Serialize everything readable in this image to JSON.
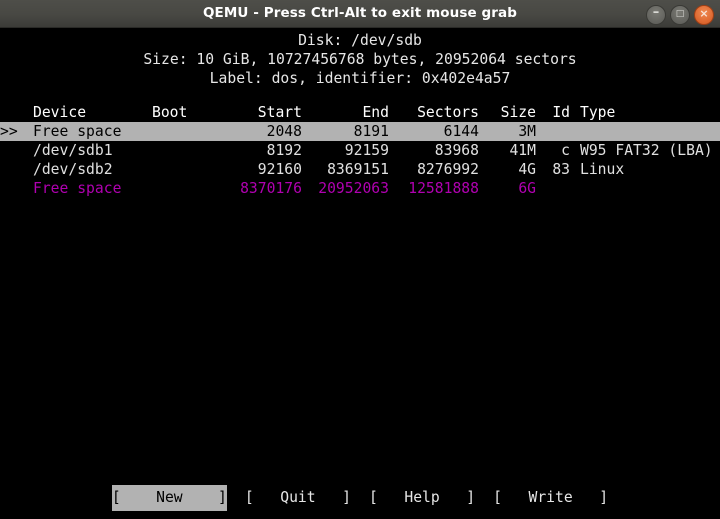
{
  "window": {
    "title": "QEMU - Press Ctrl-Alt to exit mouse grab",
    "controls": {
      "minimize_label": "–",
      "maximize_label": "□",
      "close_label": "×"
    }
  },
  "colors": {
    "titlebar": "#484843",
    "terminal_bg": "#000000",
    "terminal_fg": "#d8d8d8",
    "selection_bg": "#b2b2b2",
    "selection_fg": "#000000",
    "freespace_magenta": "#b000b0",
    "close_button": "#e06b33"
  },
  "disk_header": {
    "line1": "Disk: /dev/sdb",
    "line2": "Size: 10 GiB, 10727456768 bytes, 20952064 sectors",
    "line3": "Label: dos, identifier: 0x402e4a57"
  },
  "table": {
    "columns": {
      "device": "Device",
      "boot": "Boot",
      "start": "Start",
      "end": "End",
      "sectors": "Sectors",
      "size": "Size",
      "id": "Id",
      "type": "Type"
    },
    "rows": [
      {
        "marker": ">>",
        "device": "Free space",
        "boot": "",
        "start": "2048",
        "end": "8191",
        "sectors": "6144",
        "size": "3M",
        "id": "",
        "type": "",
        "state": "selected"
      },
      {
        "marker": "",
        "device": "/dev/sdb1",
        "boot": "",
        "start": "8192",
        "end": "92159",
        "sectors": "83968",
        "size": "41M",
        "id": "c",
        "type": "W95 FAT32 (LBA)",
        "state": "normal"
      },
      {
        "marker": "",
        "device": "/dev/sdb2",
        "boot": "",
        "start": "92160",
        "end": "8369151",
        "sectors": "8276992",
        "size": "4G",
        "id": "83",
        "type": "Linux",
        "state": "normal"
      },
      {
        "marker": "",
        "device": "Free space",
        "boot": "",
        "start": "8370176",
        "end": "20952063",
        "sectors": "12581888",
        "size": "6G",
        "id": "",
        "type": "",
        "state": "freespace"
      }
    ]
  },
  "menu": {
    "buttons": [
      {
        "label": "[    New    ]",
        "name": "new",
        "selected": true
      },
      {
        "label": "[   Quit   ]",
        "name": "quit",
        "selected": false
      },
      {
        "label": "[   Help   ]",
        "name": "help",
        "selected": false
      },
      {
        "label": "[   Write   ]",
        "name": "write",
        "selected": false
      }
    ]
  }
}
